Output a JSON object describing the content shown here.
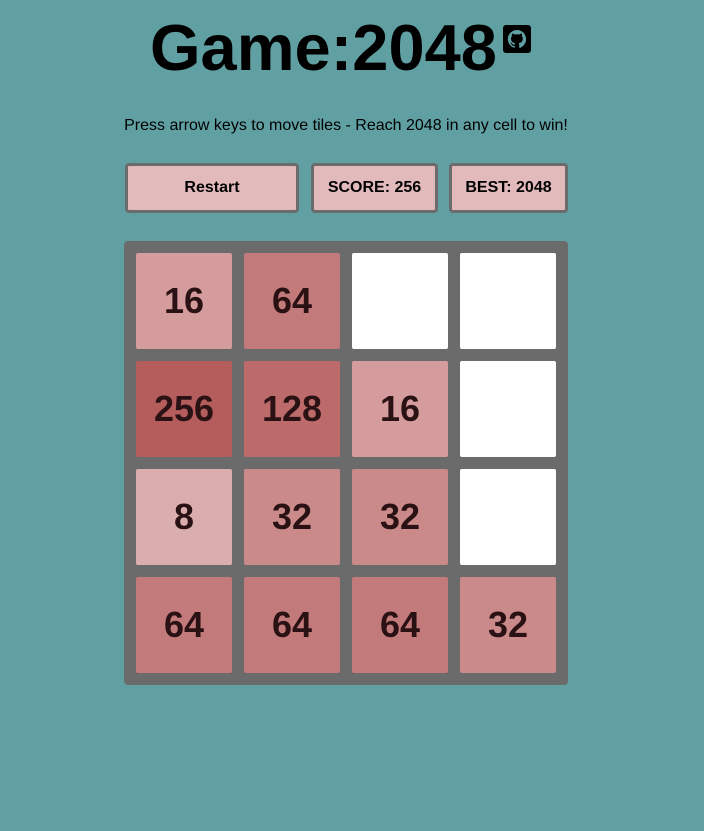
{
  "header": {
    "title": "Game:2048",
    "github_icon": "github-icon"
  },
  "instructions": "Press arrow keys to move tiles - Reach 2048 in any cell to win!",
  "controls": {
    "restart_label": "Restart",
    "score_label": "SCORE: 256",
    "best_label": "BEST: 2048"
  },
  "board": {
    "size": 4,
    "cells": [
      [
        16,
        64,
        null,
        null
      ],
      [
        256,
        128,
        16,
        null
      ],
      [
        8,
        32,
        32,
        null
      ],
      [
        64,
        64,
        64,
        32
      ]
    ]
  },
  "colors": {
    "background": "#609fa2",
    "board": "#6b6b6b",
    "empty": "#ffffff",
    "button": "#e3babb",
    "tile_8": "#dbaeae",
    "tile_16": "#d49c9c",
    "tile_32": "#cb8a8a",
    "tile_64": "#c27a7a",
    "tile_128": "#bc6a6a",
    "tile_256": "#b55c5c"
  }
}
